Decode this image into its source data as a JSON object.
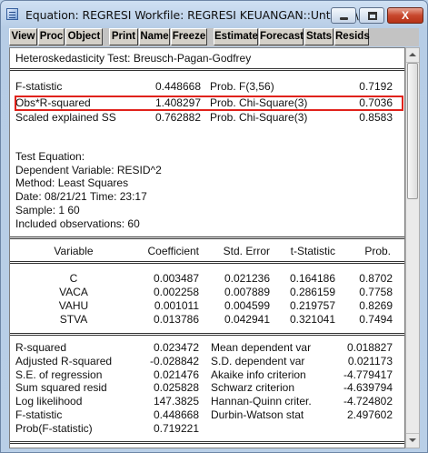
{
  "window": {
    "title": "Equation: REGRESI   Workfile: REGRESI KEUANGAN::Untitled\\",
    "min_label": "",
    "max_label": "",
    "close_label": "X"
  },
  "toolbar": [
    "View",
    "Proc",
    "Object",
    "Print",
    "Name",
    "Freeze",
    "Estimate",
    "Forecast",
    "Stats",
    "Resids"
  ],
  "test": {
    "header": "Heteroskedasticity Test: Breusch-Pagan-Godfrey",
    "rows": [
      {
        "label": "F-statistic",
        "value": "0.448668",
        "prob_label": "Prob. F(3,56)",
        "prob": "0.7192"
      },
      {
        "label": "Obs*R-squared",
        "value": "1.408297",
        "prob_label": "Prob. Chi-Square(3)",
        "prob": "0.7036"
      },
      {
        "label": "Scaled explained SS",
        "value": "0.762882",
        "prob_label": "Prob. Chi-Square(3)",
        "prob": "0.8583"
      }
    ]
  },
  "equation": {
    "lines": [
      "Test Equation:",
      "Dependent Variable: RESID^2",
      "Method: Least Squares",
      "Date: 08/21/21   Time: 23:17",
      "Sample: 1 60",
      "Included observations: 60"
    ]
  },
  "coef_table": {
    "headers": [
      "Variable",
      "Coefficient",
      "Std. Error",
      "t-Statistic",
      "Prob."
    ],
    "rows": [
      [
        "C",
        "0.003487",
        "0.021236",
        "0.164186",
        "0.8702"
      ],
      [
        "VACA",
        "0.002258",
        "0.007889",
        "0.286159",
        "0.7758"
      ],
      [
        "VAHU",
        "0.001011",
        "0.004599",
        "0.219757",
        "0.8269"
      ],
      [
        "STVA",
        "0.013786",
        "0.042941",
        "0.321041",
        "0.7494"
      ]
    ]
  },
  "stats": {
    "left": [
      [
        "R-squared",
        "0.023472"
      ],
      [
        "Adjusted R-squared",
        "-0.028842"
      ],
      [
        "S.E. of regression",
        "0.021476"
      ],
      [
        "Sum squared resid",
        "0.025828"
      ],
      [
        "Log likelihood",
        "147.3825"
      ],
      [
        "F-statistic",
        "0.448668"
      ],
      [
        "Prob(F-statistic)",
        "0.719221"
      ]
    ],
    "right": [
      [
        "Mean dependent var",
        "0.018827"
      ],
      [
        "S.D. dependent var",
        "0.021173"
      ],
      [
        "Akaike info criterion",
        "-4.779417"
      ],
      [
        "Schwarz criterion",
        "-4.639794"
      ],
      [
        "Hannan-Quinn criter.",
        "-4.724802"
      ],
      [
        "Durbin-Watson stat",
        "2.497602"
      ]
    ]
  },
  "colors": {
    "highlight": "#e0221b",
    "titlebar": "#bcd2ea"
  }
}
